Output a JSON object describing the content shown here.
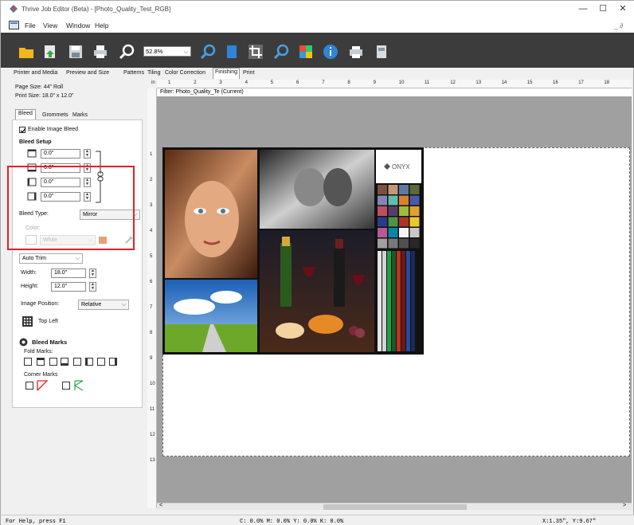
{
  "window": {
    "title": "Thrive Job Editor (Beta) - [Photo_Quality_Test_RGB]",
    "controls": {
      "minimize": "—",
      "maximize": "☐",
      "close": "✕"
    }
  },
  "menu": {
    "items": [
      "File",
      "View",
      "Window",
      "Help"
    ],
    "mdi_controls": "_ ∂"
  },
  "toolbar": {
    "zoom_value": "52.8%",
    "icons": [
      "open-folder-icon",
      "import-icon",
      "save-icon",
      "print-icon",
      "search-icon",
      "zoom-out-icon",
      "zoom-in-icon",
      "page-icon",
      "crop-icon",
      "find-icon",
      "color-icon",
      "info-icon",
      "printer-icon",
      "device-icon"
    ]
  },
  "tabs": [
    "Printer and Media",
    "Preview and Size",
    "Patterns",
    "Tiling",
    "Color Correction",
    "Finishing",
    "Print"
  ],
  "active_tab": "Finishing",
  "panel": {
    "page_size": "Page Size: 44\" Roll",
    "print_size": "Print Size: 18.0\" x 12.0\"",
    "subtabs": [
      "Bleed",
      "Grommets",
      "Marks"
    ],
    "enable_bleed": "Enable Image Bleed",
    "bleed_setup": "Bleed Setup",
    "bleed_values": [
      "0.0\"",
      "0.0\"",
      "0.0\"",
      "0.0\""
    ],
    "bleed_type_label": "Bleed Type:",
    "bleed_type_value": "Mirror",
    "color_label": "Color:",
    "color_value": "White",
    "trim_mode": "Auto Trim",
    "width_label": "Width:",
    "width_value": "18.0\"",
    "height_label": "Height:",
    "height_value": "12.0\"",
    "image_position_label": "Image Position:",
    "image_position_value": "Relative",
    "anchor_label": "Top Left",
    "bleed_marks": "Bleed Marks",
    "fold_marks": "Fold Marks:",
    "corner_marks": "Corner Marks"
  },
  "ruler": {
    "h_marks": [
      "1",
      "2",
      "3",
      "4",
      "5",
      "6",
      "7",
      "8",
      "9",
      "10",
      "11",
      "12",
      "13",
      "14",
      "15",
      "16",
      "17",
      "18"
    ],
    "v_marks": [
      "1",
      "2",
      "3",
      "4",
      "5",
      "6",
      "7",
      "8",
      "9",
      "10",
      "11",
      "12",
      "13"
    ],
    "origin": "in"
  },
  "filter_label": "Filter: Photo_Quality_Te (Current)",
  "image": {
    "logo_text": "ONYX"
  },
  "status": {
    "help": "For Help, press F1",
    "ink": "C:  0.0% M:  0.0% Y:  0.0% K:  0.0%",
    "coords": "X:1.35\", Y:9.67\""
  }
}
